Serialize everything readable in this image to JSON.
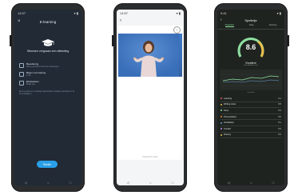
{
  "phone1": {
    "status_time": "14:57",
    "title": "E-learning",
    "welcome": "Stimmen vergusan een afleeding",
    "options": [
      {
        "title": "Beoefening",
        "desc": "Wat je geoefend met korte oefeningen"
      },
      {
        "title": "Begin met training",
        "desc": "6 min"
      },
      {
        "title": "Eindtoetsen",
        "desc": "Bekijk tips"
      }
    ],
    "note": "Eerst eerste les is volledig ingescholand, bekijken aanvullen in de les lesstappen.",
    "start_label": "Starten",
    "nav": [
      "◁",
      "○",
      "□"
    ]
  },
  "phone2": {
    "status_time": "14:57",
    "close_label": "×",
    "video_footer": "Powered by video",
    "nav": [
      "◁",
      "○",
      "□"
    ]
  },
  "phone3": {
    "status_time": "9:41",
    "title": "Spelletje",
    "tabs": [
      "Overzicht",
      "Data",
      "Ranking"
    ],
    "score": "8.6",
    "grade": "Excellent",
    "sub_label": "Gemiddelde score",
    "chart_label": "Last time",
    "categories": [
      {
        "name": "Learning",
        "value": "9.1"
      },
      {
        "name": "Writing notes",
        "value": "8.8"
      },
      {
        "name": "Story",
        "value": "8.3"
      },
      {
        "name": "Pronunciation",
        "value": "8.6"
      },
      {
        "name": "Vocabulary",
        "value": "8.1"
      },
      {
        "name": "Contact",
        "value": "8.5"
      },
      {
        "name": "Fluency",
        "value": "8.4"
      }
    ],
    "colors": {
      "accent": "#8ee0a0",
      "gauge": "#e8c04a"
    },
    "nav": [
      "◁",
      "○",
      "□"
    ]
  }
}
